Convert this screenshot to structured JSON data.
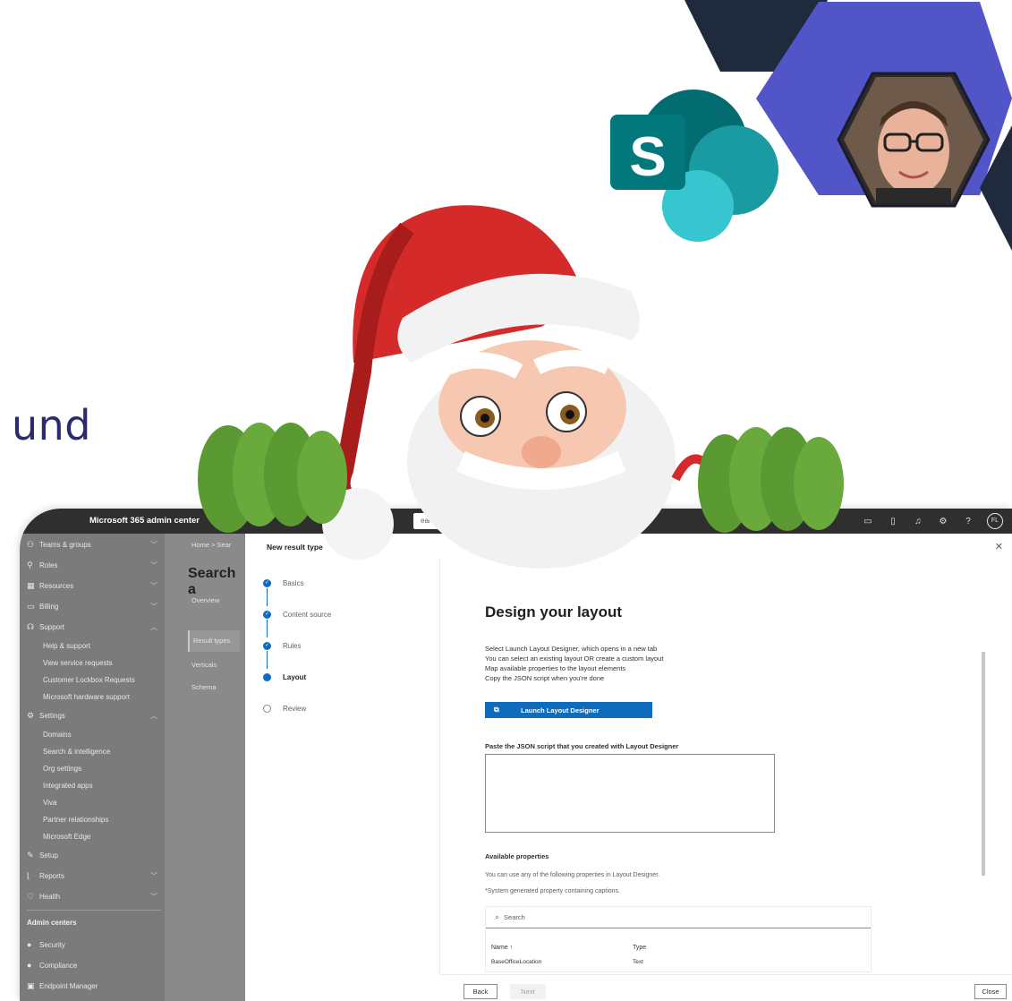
{
  "heading_fragment": "und",
  "logo_letter": "S",
  "admin": {
    "brand": "Microsoft 365 admin center",
    "search_placeholder": "earch",
    "avatar_initials": "FL",
    "nav": [
      {
        "icon": "people-icon",
        "label": "Teams & groups",
        "chevron": "﹀"
      },
      {
        "icon": "roles-icon",
        "label": "Roles",
        "chevron": "﹀"
      },
      {
        "icon": "resources-icon",
        "label": "Resources",
        "chevron": "﹀"
      },
      {
        "icon": "billing-icon",
        "label": "Billing",
        "chevron": "﹀"
      },
      {
        "icon": "support-icon",
        "label": "Support",
        "chevron": "︿"
      },
      {
        "label": "Help & support"
      },
      {
        "label": "View service requests"
      },
      {
        "label": "Customer Lockbox Requests"
      },
      {
        "label": "Microsoft hardware support"
      },
      {
        "icon": "gear-icon",
        "label": "Settings",
        "chevron": "︿"
      },
      {
        "label": "Domains"
      },
      {
        "label": "Search & intelligence"
      },
      {
        "label": "Org settings"
      },
      {
        "label": "Integrated apps"
      },
      {
        "label": "Viva"
      },
      {
        "label": "Partner relationships"
      },
      {
        "label": "Microsoft Edge"
      },
      {
        "icon": "setup-icon",
        "label": "Setup"
      },
      {
        "icon": "reports-icon",
        "label": "Reports",
        "chevron": "﹀"
      },
      {
        "icon": "health-icon",
        "label": "Health",
        "chevron": "﹀"
      }
    ],
    "admin_centers_header": "Admin centers",
    "admin_centers": [
      {
        "icon": "shield-icon",
        "label": "Security"
      },
      {
        "icon": "shield-icon",
        "label": "Compliance"
      },
      {
        "icon": "endpoint-icon",
        "label": "Endpoint Manager"
      }
    ],
    "breadcrumb": "Home  >  Sear",
    "page_heading": "Search a",
    "tabs": {
      "overview": "Overview"
    },
    "subnav": {
      "result_types": "Result types",
      "verticals": "Verticals",
      "schema": "Schema"
    }
  },
  "panel": {
    "title": "New result type",
    "close_icon": "✕",
    "steps": [
      {
        "label": "Basics",
        "state": "done"
      },
      {
        "label": "Content source",
        "state": "done"
      },
      {
        "label": "Rules",
        "state": "done"
      },
      {
        "label": "Layout",
        "state": "current"
      },
      {
        "label": "Review",
        "state": "todo"
      }
    ],
    "heading": "Design your layout",
    "instructions": [
      "Select Launch Layout Designer, which opens in a new tab",
      "You can select an existing layout OR create a custom layout",
      "Map available properties to the layout elements",
      "Copy the JSON script when you're done"
    ],
    "launch_button": "Launch Layout Designer",
    "paste_label": "Paste the JSON script that you created with Layout Designer",
    "textarea_value": "",
    "available_label": "Available properties",
    "available_desc": "You can use any of the following properties in Layout Designer.",
    "system_note": "*System generated property containing captions.",
    "prop_search_placeholder": "Search",
    "table": {
      "col_name": "Name ↑",
      "col_type": "Type",
      "rows": [
        {
          "name": "BaseOfficeLocation",
          "type": "Text"
        }
      ]
    },
    "back_button": "Back",
    "next_button": "Next",
    "close_button": "Close"
  },
  "colors": {
    "navy": "#2b2a6e",
    "purple": "#5155c8",
    "sharepoint_dark": "#036c70",
    "sharepoint_mid": "#1a9ba1",
    "sharepoint_light": "#37c6d0",
    "fluent_blue": "#0f6cbd",
    "santa_red": "#d42a2a",
    "glove_green": "#5b9a32"
  }
}
